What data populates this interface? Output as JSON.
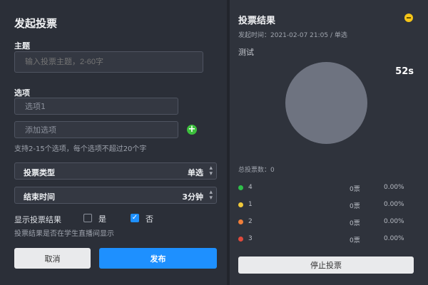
{
  "form": {
    "title": "发起投票",
    "topic_label": "主题",
    "topic_placeholder": "输入投票主题，2-60字",
    "options_label": "选项",
    "options": [
      "选项1"
    ],
    "add_option_placeholder": "添加选项",
    "options_hint": "支持2-15个选项，每个选项不超过20个字",
    "vote_type": {
      "label": "投票类型",
      "value": "单选"
    },
    "end_time": {
      "label": "结束时间",
      "value": "3分钟"
    },
    "show_results": {
      "label": "显示投票结果",
      "yes_label": "是",
      "yes_checked": false,
      "no_label": "否",
      "no_checked": true,
      "hint": "投票结果是否在学生直播间显示"
    },
    "cancel_label": "取消",
    "publish_label": "发布"
  },
  "results": {
    "title": "投票结果",
    "meta": "发起时间：2021-02-07 21:05 / 单选",
    "question": "测试",
    "timer": "52s",
    "total_label": "总投票数：0",
    "rows": [
      {
        "option": "4",
        "count": "0票",
        "percent": "0.00%",
        "color": "#2fbf4a"
      },
      {
        "option": "1",
        "count": "0票",
        "percent": "0.00%",
        "color": "#f0c93b"
      },
      {
        "option": "2",
        "count": "0票",
        "percent": "0.00%",
        "color": "#f07f3a"
      },
      {
        "option": "3",
        "count": "0票",
        "percent": "0.00%",
        "color": "#e04a3c"
      }
    ],
    "stop_label": "停止投票"
  },
  "colors": {
    "accent": "#1e90ff",
    "add_green": "#3cbf3c",
    "minimize_yellow": "#f5c518",
    "pie_gray": "#6e7380"
  },
  "icons": {
    "add": "plus-circle-icon",
    "minimize": "minimize-icon",
    "select_arrow": "chevron-up-down-icon",
    "checkbox_checked": "check-icon"
  }
}
